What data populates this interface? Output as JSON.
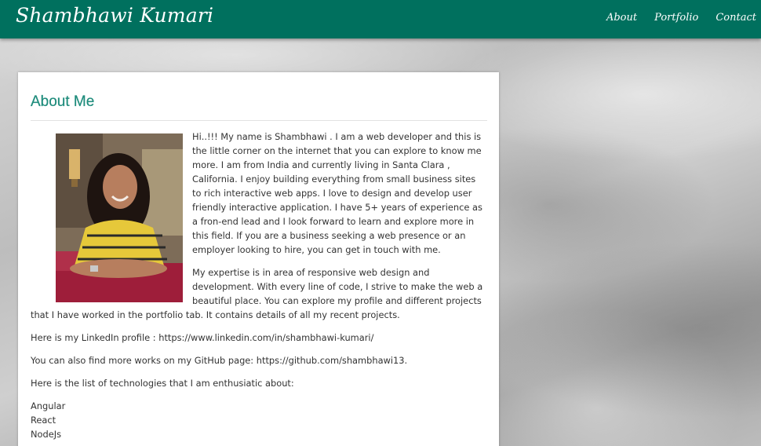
{
  "header": {
    "brand": "Shambhawi Kumari",
    "nav": [
      {
        "label": "About"
      },
      {
        "label": "Portfolio"
      },
      {
        "label": "Contact"
      }
    ]
  },
  "about": {
    "title": "About Me",
    "paragraphs": [
      "Hi..!!! My name is Shambhawi . I am a web developer and this is the little corner on the internet that you can explore to know me more. I am from India and currently living in Santa Clara , California. I enjoy building everything from small business sites to rich interactive web apps. I love to design and develop user friendly interactive application. I have 5+ years of experience as a fron-end lead and I look forward to learn and explore more in this field. If you are a business seeking a web presence or an employer looking to hire, you can get in touch with me.",
      "My expertise is in area of responsive web design and development. With every line of code, I strive to make the web a beautiful place. You can explore my profile and different projects that I have worked in the portfolio tab. It contains details of all my recent projects.",
      "Here is my LinkedIn profile : https://www.linkedin.com/in/shambhawi-kumari/",
      "You can also find more works on my GitHub page: https://github.com/shambhawi13.",
      "Here is the list of technologies that I am enthusiatic about:"
    ],
    "technologies": [
      "Angular",
      "React",
      "NodeJs"
    ]
  },
  "colors": {
    "navbar": "#00705e",
    "heading": "#1f8c7c"
  }
}
